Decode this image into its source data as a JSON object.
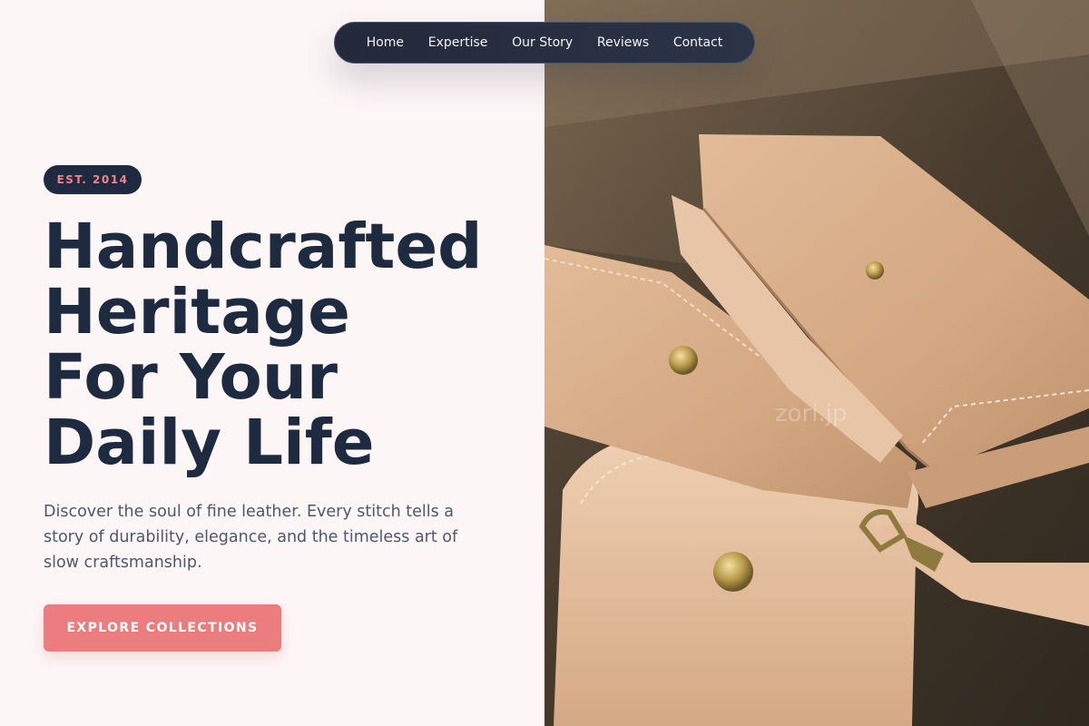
{
  "nav": {
    "items": [
      {
        "label": "Home"
      },
      {
        "label": "Expertise"
      },
      {
        "label": "Our Story"
      },
      {
        "label": "Reviews"
      },
      {
        "label": "Contact"
      }
    ]
  },
  "hero": {
    "badge": "EST. 2014",
    "headline_lines": [
      "Handcrafted",
      "Heritage",
      "For Your",
      "Daily Life"
    ],
    "description": "Discover the soul of fine leather. Every stitch tells a story of durability, elegance, and the timeless art of slow craftsmanship.",
    "cta_label": "EXPLORE COLLECTIONS"
  },
  "image": {
    "watermark": "zori.jp"
  },
  "colors": {
    "background": "#fdf6f7",
    "navy": "#1e2a40",
    "accent": "#ec7d7f",
    "badge_text": "#f0848b",
    "body_text": "#4c586b"
  }
}
